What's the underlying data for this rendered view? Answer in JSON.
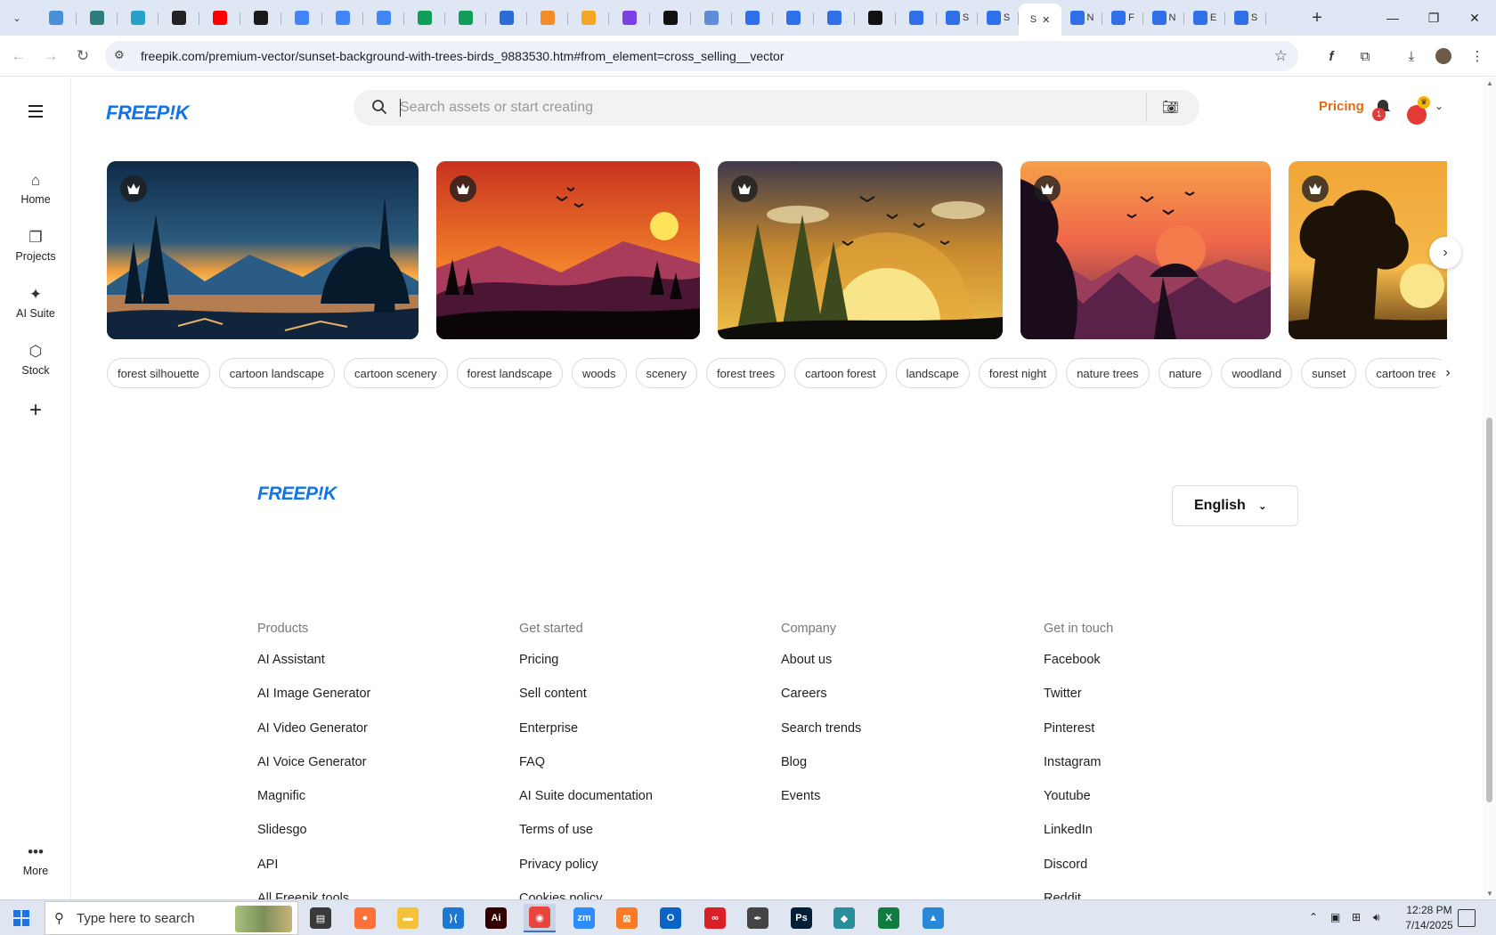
{
  "browser": {
    "tabs": [
      {
        "color": "#4a90d9",
        "text": ""
      },
      {
        "color": "#2e7d7d",
        "text": ""
      },
      {
        "color": "#27a1c9",
        "text": ""
      },
      {
        "color": "#222222",
        "text": ""
      },
      {
        "color": "#ff0000",
        "text": ""
      },
      {
        "color": "#1a1a1a",
        "text": ""
      },
      {
        "color": "#4285f4",
        "text": ""
      },
      {
        "color": "#4285f4",
        "text": ""
      },
      {
        "color": "#4285f4",
        "text": ""
      },
      {
        "color": "#0f9d58",
        "text": ""
      },
      {
        "color": "#0f9d58",
        "text": ""
      },
      {
        "color": "#2b6cd6",
        "text": ""
      },
      {
        "color": "#f28c28",
        "text": ""
      },
      {
        "color": "#f5a623",
        "text": ""
      },
      {
        "color": "#7b3fe4",
        "text": ""
      },
      {
        "color": "#111111",
        "text": ""
      },
      {
        "color": "#5b8dd9",
        "text": ""
      },
      {
        "color": "#2f6fe8",
        "text": ""
      },
      {
        "color": "#2f6fe8",
        "text": ""
      },
      {
        "color": "#2f6fe8",
        "text": ""
      },
      {
        "color": "#111111",
        "text": ""
      },
      {
        "color": "#2f6fe8",
        "text": ""
      },
      {
        "color": "#2f6fe8",
        "text": "S"
      },
      {
        "color": "#2f6fe8",
        "text": "S"
      },
      {
        "color": "",
        "text": "S",
        "active": true
      },
      {
        "color": "#2f6fe8",
        "text": "N"
      },
      {
        "color": "#2f6fe8",
        "text": "F"
      },
      {
        "color": "#2f6fe8",
        "text": "N"
      },
      {
        "color": "#2f6fe8",
        "text": "E"
      },
      {
        "color": "#2f6fe8",
        "text": "S"
      }
    ],
    "url_host": "freepik.com",
    "url_path": "/premium-vector/sunset-background-with-trees-birds_9883530.htm#from_element=cross_selling__vector"
  },
  "header": {
    "logo": "FREEP!K",
    "search_placeholder": "Search assets or start creating",
    "pricing": "Pricing",
    "notification_count": "1"
  },
  "rail": {
    "items": [
      {
        "label": "Home"
      },
      {
        "label": "Projects"
      },
      {
        "label": "AI Suite"
      },
      {
        "label": "Stock"
      }
    ],
    "more": "More"
  },
  "tags": [
    "forest silhouette",
    "cartoon landscape",
    "cartoon scenery",
    "forest landscape",
    "woods",
    "scenery",
    "forest trees",
    "cartoon forest",
    "landscape",
    "forest night",
    "nature trees",
    "nature",
    "woodland",
    "sunset",
    "cartoon tree"
  ],
  "footer": {
    "logo": "FREEP!K",
    "language": "English",
    "columns": [
      {
        "title": "Products",
        "links": [
          "AI Assistant",
          "AI Image Generator",
          "AI Video Generator",
          "AI Voice Generator",
          "Magnific",
          "Slidesgo",
          "API",
          "All Freepik tools"
        ]
      },
      {
        "title": "Get started",
        "links": [
          "Pricing",
          "Sell content",
          "Enterprise",
          "FAQ",
          "AI Suite documentation",
          "Terms of use",
          "Privacy policy",
          "Cookies policy"
        ]
      },
      {
        "title": "Company",
        "links": [
          "About us",
          "Careers",
          "Search trends",
          "Blog",
          "Events"
        ]
      },
      {
        "title": "Get in touch",
        "links": [
          "Facebook",
          "Twitter",
          "Pinterest",
          "Instagram",
          "Youtube",
          "LinkedIn",
          "Discord",
          "Reddit"
        ]
      }
    ]
  },
  "taskbar": {
    "search_text": "Type here to search",
    "time": "12:28 PM",
    "date": "7/14/2025",
    "apps": [
      {
        "name": "task-view",
        "color": "#3a3a3a",
        "label": "▤"
      },
      {
        "name": "firefox",
        "color": "#ff7139",
        "label": "●"
      },
      {
        "name": "file-explorer",
        "color": "#f3c13a",
        "label": "▬"
      },
      {
        "name": "vscode",
        "color": "#1e78d2",
        "label": "⟩⟨"
      },
      {
        "name": "illustrator",
        "color": "#330000",
        "label": "Ai"
      },
      {
        "name": "chrome",
        "color": "#e8453c",
        "label": "◉",
        "active": true
      },
      {
        "name": "zoom",
        "color": "#2d8cff",
        "label": "zm"
      },
      {
        "name": "xampp",
        "color": "#fb7a24",
        "label": "⊠"
      },
      {
        "name": "outlook",
        "color": "#0a64c8",
        "label": "O"
      },
      {
        "name": "creative-cloud",
        "color": "#da1f26",
        "label": "∞"
      },
      {
        "name": "pen-tool",
        "color": "#444444",
        "label": "✒"
      },
      {
        "name": "photoshop",
        "color": "#001e36",
        "label": "Ps"
      },
      {
        "name": "app-diamond",
        "color": "#2a8f9a",
        "label": "◆"
      },
      {
        "name": "excel",
        "color": "#107c41",
        "label": "X"
      },
      {
        "name": "photos",
        "color": "#2b88d8",
        "label": "▲"
      }
    ]
  }
}
